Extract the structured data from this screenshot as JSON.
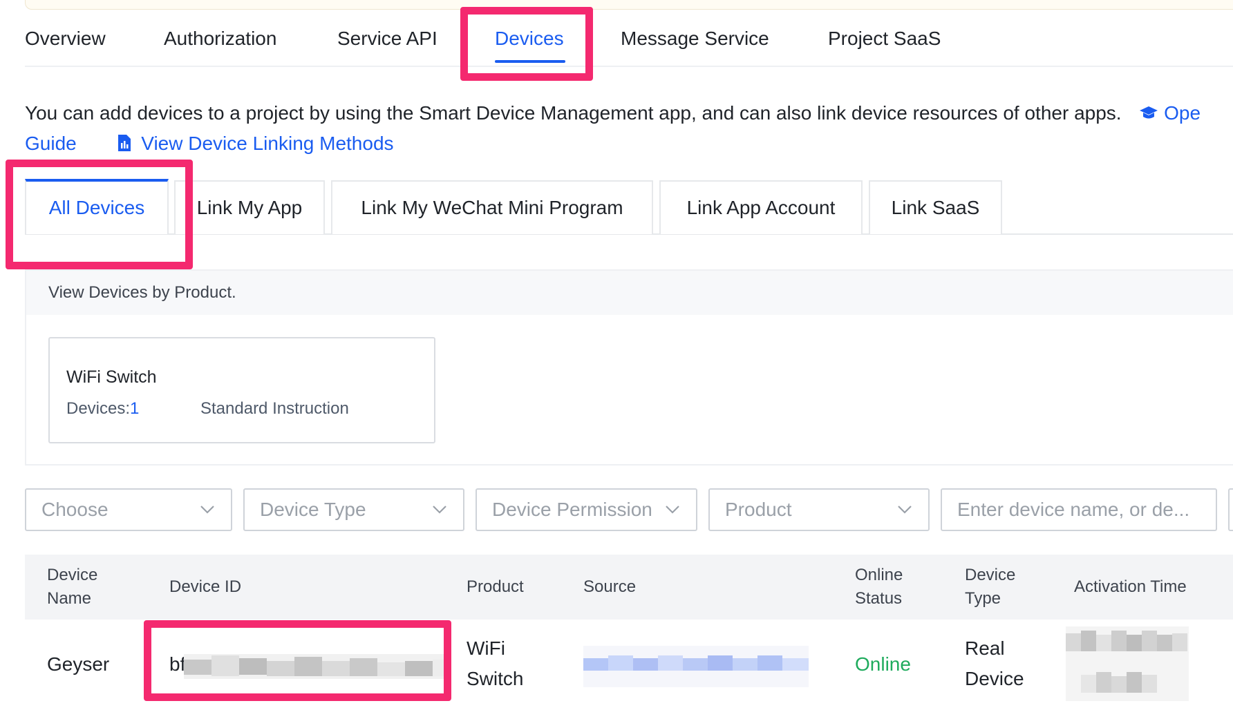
{
  "main_tabs": [
    "Overview",
    "Authorization",
    "Service API",
    "Devices",
    "Message Service",
    "Project SaaS"
  ],
  "active_main_tab": "Devices",
  "info": {
    "text": "You can add devices to a project by using the Smart Device Management app, and can also link device resources of other apps.",
    "op_link": "Ope",
    "guide": "Guide",
    "view_methods": "View Device Linking Methods"
  },
  "sub_tabs": [
    "All Devices",
    "Link My App",
    "Link My WeChat Mini Program",
    "Link App Account",
    "Link SaaS"
  ],
  "active_sub_tab": "All Devices",
  "product_panel": {
    "header": "View Devices by Product.",
    "card": {
      "title": "WiFi Switch",
      "devices_label": "Devices:",
      "devices_count": "1",
      "instruction": "Standard Instruction"
    }
  },
  "filters": {
    "choose": "Choose",
    "device_type": "Device Type",
    "device_permission": "Device Permission",
    "product": "Product",
    "search_placeholder": "Enter device name, or de..."
  },
  "table": {
    "headers": {
      "device_name": [
        "Device",
        "Name"
      ],
      "device_id": "Device ID",
      "product": "Product",
      "source": "Source",
      "online_status": [
        "Online",
        "Status"
      ],
      "device_type": [
        "Device",
        "Type"
      ],
      "activation_time": "Activation Time"
    },
    "rows": [
      {
        "device_name": "Geyser",
        "device_id_prefix": "bf",
        "product": [
          "WiFi",
          "Switch"
        ],
        "online_status": "Online",
        "device_type": [
          "Real",
          "Device"
        ]
      }
    ]
  },
  "colors": {
    "accent": "#1a5cf0",
    "highlight": "#f4296f",
    "online": "#1fab5d"
  }
}
